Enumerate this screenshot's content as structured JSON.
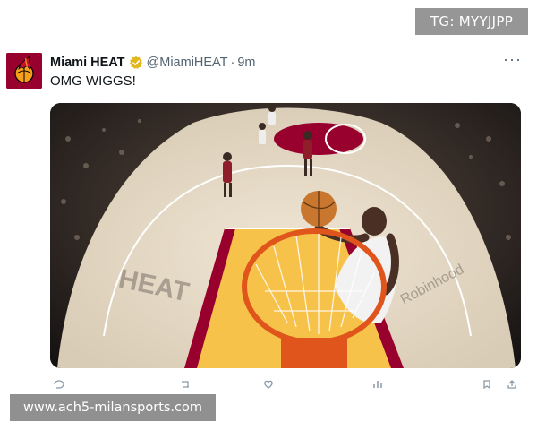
{
  "watermark_top": "TG: MYYJJPP",
  "tweet": {
    "display_name": "Miami HEAT",
    "handle": "@MiamiHEAT",
    "separator": "·",
    "time": "9m",
    "more_label": "···",
    "text": "OMG WIGGS!"
  },
  "media": {
    "court_logos": [
      "HEAT",
      "Robinhood"
    ],
    "accent_color": "#98002e"
  },
  "actions": [
    "reply-icon",
    "retweet-icon",
    "like-icon",
    "views-icon",
    "bookmark-icon",
    "share-icon"
  ],
  "watermark_bottom": "www.ach5-milansports.com",
  "colors": {
    "heat_red": "#98002e",
    "verified_gold": "#e2b719",
    "text_primary": "#0f1419",
    "text_secondary": "#536471"
  }
}
